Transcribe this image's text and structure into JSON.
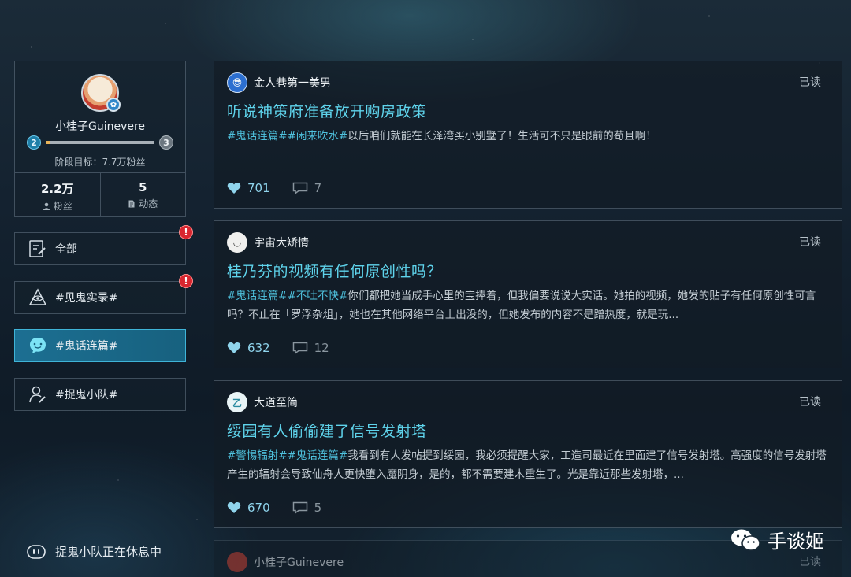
{
  "profile": {
    "username": "小桂子Guinevere",
    "level_current": "2",
    "level_next": "3",
    "progress_fraction": 0.03,
    "stage_goal": "阶段目标：7.7万粉丝",
    "followers_count": "2.2万",
    "followers_label": "粉丝",
    "posts_count": "5",
    "posts_label": "动态"
  },
  "nav": [
    {
      "label": "全部",
      "alert": "!"
    },
    {
      "label": "#见鬼实录#",
      "alert": "!"
    },
    {
      "label": "#鬼话连篇#",
      "active": true
    },
    {
      "label": "#捉鬼小队#"
    }
  ],
  "squad_status": "捉鬼小队正在休息中",
  "posts": [
    {
      "author": "金人巷第一美男",
      "read": "已读",
      "title": "听说神策府准备放开购房政策",
      "tags": "#鬼话连篇##闲来吹水#",
      "text": "以后咱们就能在长泽湾买小别墅了！生活可不只是眼前的苟且啊！",
      "likes": "701",
      "comments": "7"
    },
    {
      "author": "宇宙大矫情",
      "read": "已读",
      "title": "桂乃芬的视频有任何原创性吗？",
      "tags": "#鬼话连篇##不吐不快#",
      "text": "你们都把她当成手心里的宝捧着，但我偏要说说大实话。她拍的视频，她发的贴子有任何原创性可言吗？不止在「罗浮杂俎」，她也在其他网络平台上出没的，但她发布的内容不是蹭热度，就是玩...",
      "likes": "632",
      "comments": "12"
    },
    {
      "author": "大道至简",
      "read": "已读",
      "title": "绥园有人偷偷建了信号发射塔",
      "tags": "#警惕辐射##鬼话连篇#",
      "text": "我看到有人发帖提到绥园，我必须提醒大家，工造司最近在里面建了信号发射塔。高强度的信号发射塔产生的辐射会导致仙舟人更快堕入魔阴身，是的，都不需要建木重生了。光是靠近那些发射塔，...",
      "likes": "670",
      "comments": "5"
    },
    {
      "author": "小桂子Guinevere",
      "read": "已读"
    }
  ],
  "watermark": "手谈姬",
  "colors": {
    "accent": "#5fd4ec",
    "alert": "#d8262f",
    "active_nav": "#1c6f92"
  }
}
